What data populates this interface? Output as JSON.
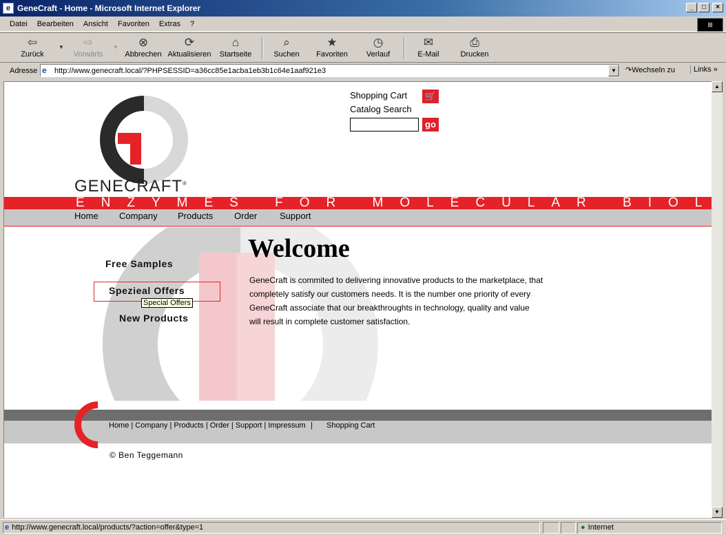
{
  "window": {
    "title": "GeneCraft - Home - Microsoft Internet Explorer",
    "minimize": "_",
    "maximize": "□",
    "close": "×"
  },
  "menu": [
    "Datei",
    "Bearbeiten",
    "Ansicht",
    "Favoriten",
    "Extras",
    "?"
  ],
  "toolbar": {
    "back": "Zurück",
    "forward": "Vorwärts",
    "stop": "Abbrechen",
    "refresh": "Aktualisieren",
    "home": "Startseite",
    "search": "Suchen",
    "favorites": "Favoriten",
    "history": "Verlauf",
    "mail": "E-Mail",
    "print": "Drucken"
  },
  "address": {
    "label": "Adresse",
    "url": "http://www.genecraft.local/?PHPSESSID=a36cc85e1acba1eb3b1c64e1aaf921e3",
    "go": "Wechseln zu",
    "links": "Links"
  },
  "header": {
    "brand": "GENECRAFT",
    "brand_mark": "®",
    "cart": "Shopping Cart",
    "catalog_search": "Catalog Search",
    "search_value": "",
    "go": "go",
    "tagline": "ENZYMES FOR MOLECULAR BIOLOGY"
  },
  "nav": [
    "Home",
    "Company",
    "Products",
    "Order",
    "Support"
  ],
  "side": {
    "free_samples": "Free Samples",
    "special_offers": "Spezieal Offers",
    "new_products": "New Products",
    "tooltip": "Special Offers"
  },
  "main": {
    "title": "Welcome",
    "intro": [
      "GeneCraft is commited to delivering innovative products to the marketplace, that",
      "completely satisfy our customers needs. It is the number one priority of every",
      "GeneCraft associate that our breakthroughts in technology, quality and value",
      "will result in complete customer satisfaction."
    ]
  },
  "footer": {
    "links": "Home | Company | Products | Order | Support | Impressum",
    "separator": "|",
    "cart": "Shopping Cart",
    "copyright": "© Ben Teggemann"
  },
  "status": {
    "text": "http://www.genecraft.local/products/?action=offer&type=1",
    "zone": "Internet"
  },
  "colors": {
    "brand_red": "#e52227",
    "nav_gray": "#c8c8c8",
    "footer_dark": "#6e6e6e"
  }
}
